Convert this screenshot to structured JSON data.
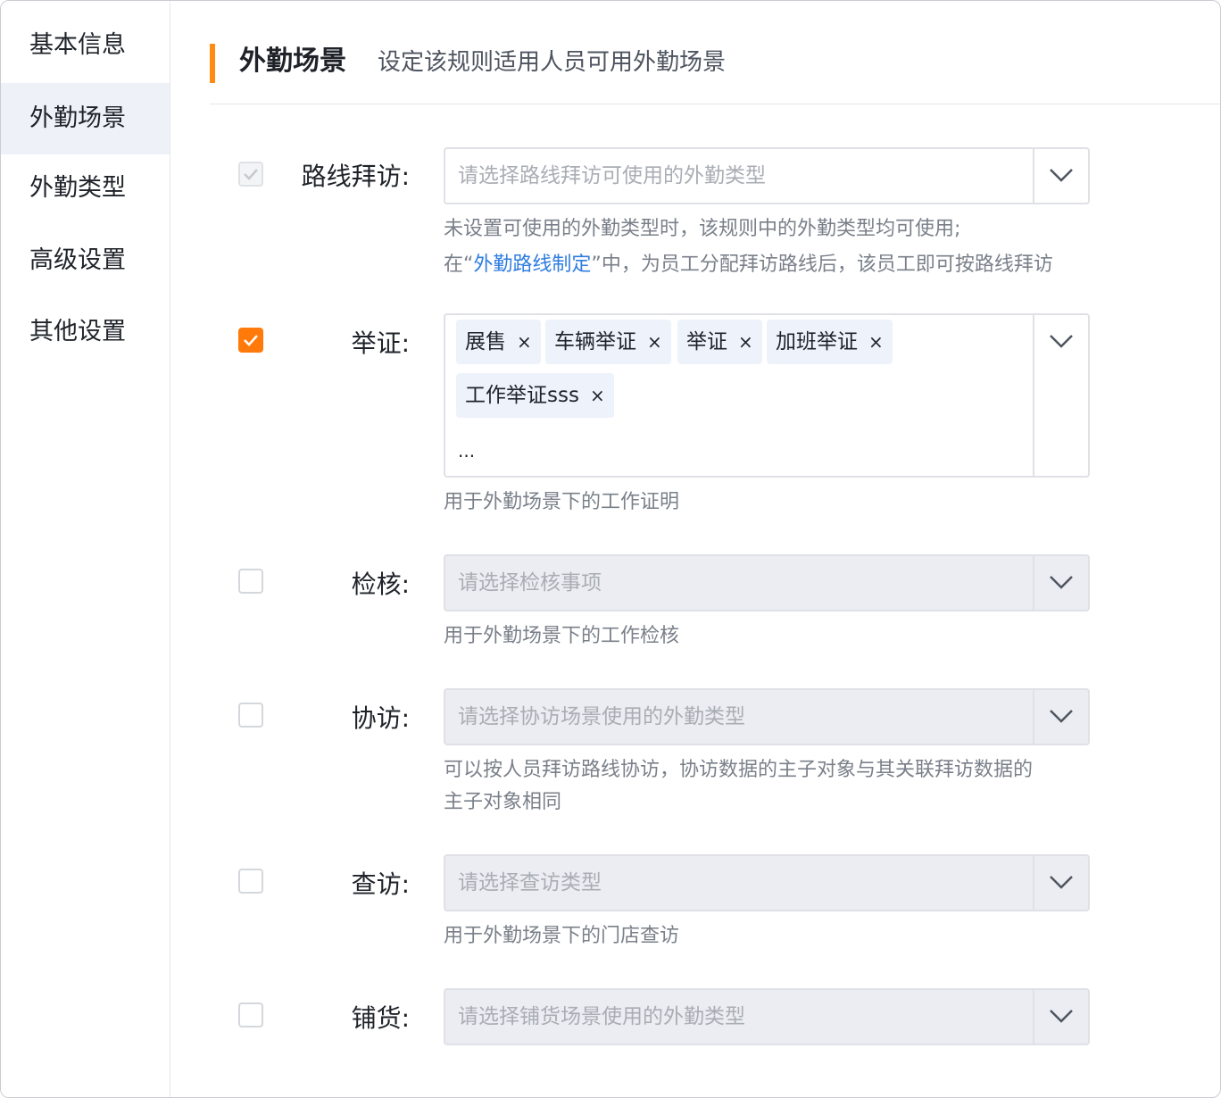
{
  "sidebar": {
    "items": [
      {
        "label": "基本信息",
        "active": false
      },
      {
        "label": "外勤场景",
        "active": true
      },
      {
        "label": "外勤类型",
        "active": false
      },
      {
        "label": "高级设置",
        "active": false
      },
      {
        "label": "其他设置",
        "active": false
      }
    ]
  },
  "header": {
    "title": "外勤场景",
    "subtitle": "设定该规则适用人员可用外勤场景",
    "accent": "#ff8a14"
  },
  "rows": {
    "route": {
      "label": "路线拜访:",
      "placeholder": "请选择路线拜访可使用的外勤类型",
      "checked": true,
      "disabled": true,
      "help_line1": "未设置可使用的外勤类型时，该规则中的外勤类型均可使用;",
      "help_prefix": "在“",
      "help_link": "外勤路线制定",
      "help_suffix": "”中，为员工分配拜访路线后，该员工即可按路线拜访"
    },
    "proof": {
      "label": "举证:",
      "checked": true,
      "tags": [
        "展售",
        "车辆举证",
        "举证",
        "加班举证",
        "工作举证sss"
      ],
      "more": "...",
      "help": "用于外勤场景下的工作证明"
    },
    "inspect": {
      "label": "检核:",
      "placeholder": "请选择检核事项",
      "checked": false,
      "help": "用于外勤场景下的工作检核"
    },
    "assist": {
      "label": "协访:",
      "placeholder": "请选择协访场景使用的外勤类型",
      "checked": false,
      "help_line1": "可以按人员拜访路线协访，协访数据的主子对象与其关联拜访数据的",
      "help_line2": "主子对象相同"
    },
    "check_visit": {
      "label": "查访:",
      "placeholder": "请选择查访类型",
      "checked": false,
      "help": "用于外勤场景下的门店查访"
    },
    "stocking": {
      "label": "铺货:",
      "placeholder": "请选择铺货场景使用的外勤类型",
      "checked": false
    }
  },
  "colors": {
    "checked": "#ff7a0a",
    "link": "#2f7de1",
    "tag_bg": "#eef2fb"
  },
  "icons": {
    "check": "check-icon",
    "dropdown": "chevron-down-icon",
    "tag_remove": "close-icon"
  },
  "tag_close_glyph": "×"
}
